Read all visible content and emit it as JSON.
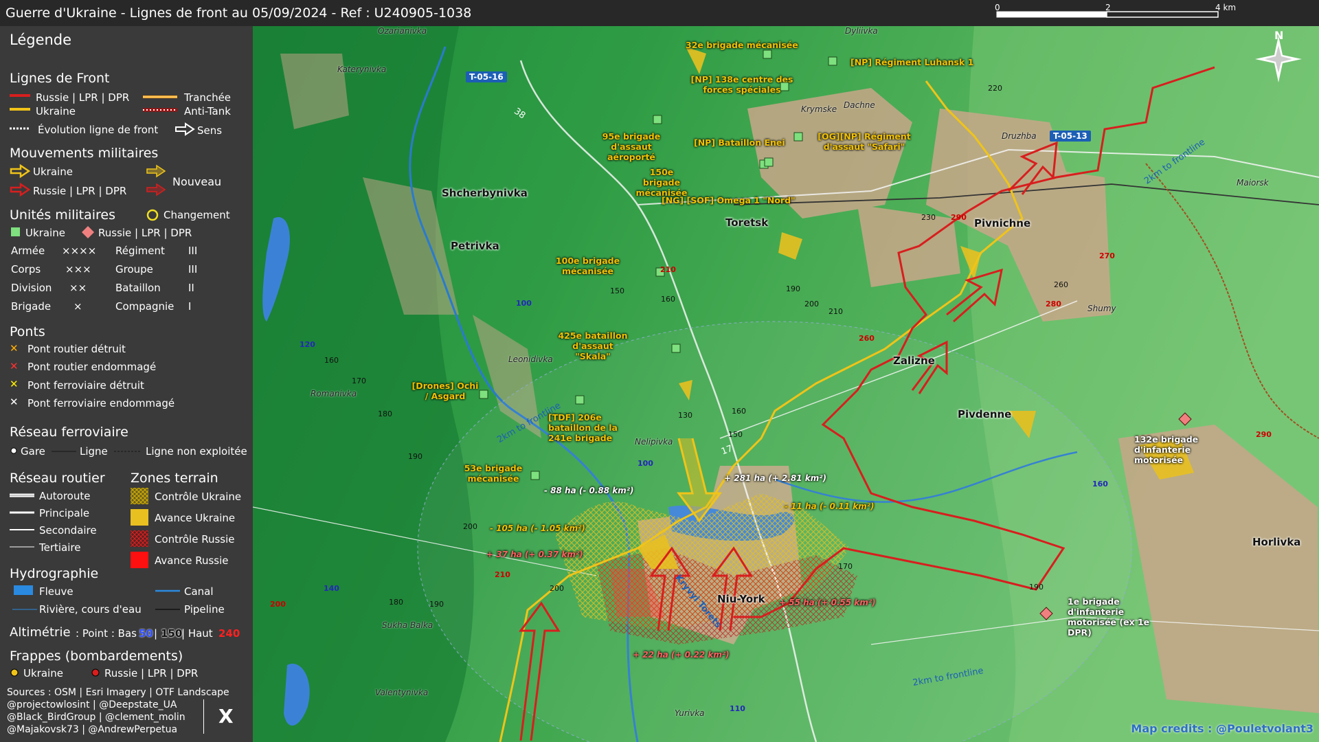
{
  "title": "Guerre d'Ukraine - Lignes de front au 05/09/2024 - Ref : U240905-1038",
  "scale": {
    "labels": [
      "0",
      "2",
      "4 km"
    ]
  },
  "north_label": "N",
  "legend": {
    "title": "Légende",
    "front_lines": {
      "heading": "Lignes de Front",
      "russia": "Russie | LPR | DPR",
      "ukraine": "Ukraine",
      "trench": "Tranchée",
      "antitank": "Anti-Tank",
      "evolution": "Évolution ligne de front",
      "direction": "Sens"
    },
    "movements": {
      "heading": "Mouvements militaires",
      "ukraine": "Ukraine",
      "russia": "Russie | LPR | DPR",
      "new": "Nouveau"
    },
    "units": {
      "heading": "Unités militaires",
      "change": "Changement",
      "ukraine": "Ukraine",
      "russia": "Russie | LPR | DPR",
      "rows": [
        {
          "a": "Armée",
          "as": "××××",
          "b": "Régiment",
          "bs": "III"
        },
        {
          "a": "Corps",
          "as": "×××",
          "b": "Groupe",
          "bs": "III"
        },
        {
          "a": "Division",
          "as": "××",
          "b": "Bataillon",
          "bs": "II"
        },
        {
          "a": "Brigade",
          "as": "×",
          "b": "Compagnie",
          "bs": "I"
        }
      ]
    },
    "bridges": {
      "heading": "Ponts",
      "items": [
        "Pont routier détruit",
        "Pont routier endommagé",
        "Pont ferroviaire détruit",
        "Pont ferroviaire endommagé"
      ]
    },
    "rail": {
      "heading": "Réseau ferroviaire",
      "station": "Gare",
      "line": "Ligne",
      "unused": "Ligne non exploitée"
    },
    "roads": {
      "heading": "Réseau routier",
      "items": [
        "Autoroute",
        "Principale",
        "Secondaire",
        "Tertiaire"
      ]
    },
    "zones": {
      "heading": "Zones terrain",
      "items": [
        "Contrôle Ukraine",
        "Avance Ukraine",
        "Contrôle Russie",
        "Avance Russie"
      ]
    },
    "hydro": {
      "heading": "Hydrographie",
      "river": "Fleuve",
      "canal": "Canal",
      "stream": "Rivière, cours d'eau",
      "pipeline": "Pipeline"
    },
    "altimetry": {
      "heading": "Altimétrie",
      "text": ": Point : Bas",
      "low": "50",
      "mid": "150",
      "high_label": "| Haut",
      "high": "240"
    },
    "strikes": {
      "heading": "Frappes (bombardements)",
      "ukraine": "Ukraine",
      "russia": "Russie | LPR | DPR"
    },
    "sources": [
      "Sources : OSM | Esri Imagery | OTF Landscape",
      "@projectowlosint | @Deepstate_UA",
      "@Black_BirdGroup | @clement_molin",
      "@Majakovsk73 | @AndrewPerpetua"
    ],
    "x_logo": "X"
  },
  "colors": {
    "russia": "#d81e1e",
    "ukraine": "#f0c419",
    "water": "#3b82d6",
    "road_badge": "#1c5fb5"
  },
  "map": {
    "cities": [
      "Shcherbynivka",
      "Petrivka",
      "Toretsk",
      "Pivnichne",
      "Zalizne",
      "Pivdenne",
      "Niu-York",
      "Horlivka"
    ],
    "villages": [
      "Katerynivka",
      "Dyliivka",
      "Krymske",
      "Dachne",
      "Druzhba",
      "Maiorsk",
      "Shumy",
      "Leonidivka",
      "Romanivka",
      "Nelipivka",
      "Sukha Balka",
      "Valentynivka",
      "Yurivka",
      "Ozarianivka"
    ],
    "road_badges": [
      "T-05-16",
      "T-05-13"
    ],
    "road_numbers": [
      "38",
      "17"
    ],
    "frontline_labels": [
      "2km to frontline",
      "2km to frontline",
      "2km to frontline"
    ],
    "rivers": [
      "Kryvyi Torets"
    ],
    "units_ukraine": [
      "32e brigade mécanisée",
      "[NP] Régiment Luhansk 1",
      "[NP] 138e centre des forces spéciales",
      "95e brigade d'assaut aéroporté",
      "[NP] Bataillon Enei",
      "[OG][NP] Régiment d'assaut \"Safari\"",
      "150e brigade mécanisée",
      "[NG] [SOF] Omega 1 \"Nord\"",
      "100e brigade mécanisée",
      "425e bataillon d'assaut \"Skala\"",
      "[Drones] Ochi / Asgard",
      "[TDF] 206e bataillon de la 241e brigade",
      "53e brigade mécanisée"
    ],
    "units_russia": [
      "132e brigade d'infanterie motorisée",
      "1e brigade d'infanterie motorisée (ex 1e DPR)"
    ],
    "area_changes": [
      {
        "text": "- 88 ha (- 0.88 km²)",
        "side": "ukraine"
      },
      {
        "text": "+ 281 ha (+ 2.81 km²)",
        "side": "ukraine"
      },
      {
        "text": "- 11 ha (- 0.11 km²)",
        "side": "ukraine"
      },
      {
        "text": "- 105 ha (- 1.05 km²)",
        "side": "ukraine"
      },
      {
        "text": "+ 37 ha (+ 0.37 km²)",
        "side": "russia"
      },
      {
        "text": "+ 55 ha (+ 0.55 km²)",
        "side": "russia"
      },
      {
        "text": "+ 22 ha (+ 0.22 km²)",
        "side": "russia"
      }
    ],
    "altitudes": [
      "220",
      "230",
      "290",
      "270",
      "280",
      "260",
      "210",
      "150",
      "160",
      "190",
      "200",
      "210",
      "260",
      "120",
      "160",
      "170",
      "180",
      "130",
      "160",
      "150",
      "100",
      "190",
      "100",
      "160",
      "200",
      "210",
      "200",
      "180",
      "190",
      "170",
      "140",
      "200",
      "190",
      "290",
      "110"
    ]
  },
  "credits": "Map credits : @Pouletvolant3"
}
